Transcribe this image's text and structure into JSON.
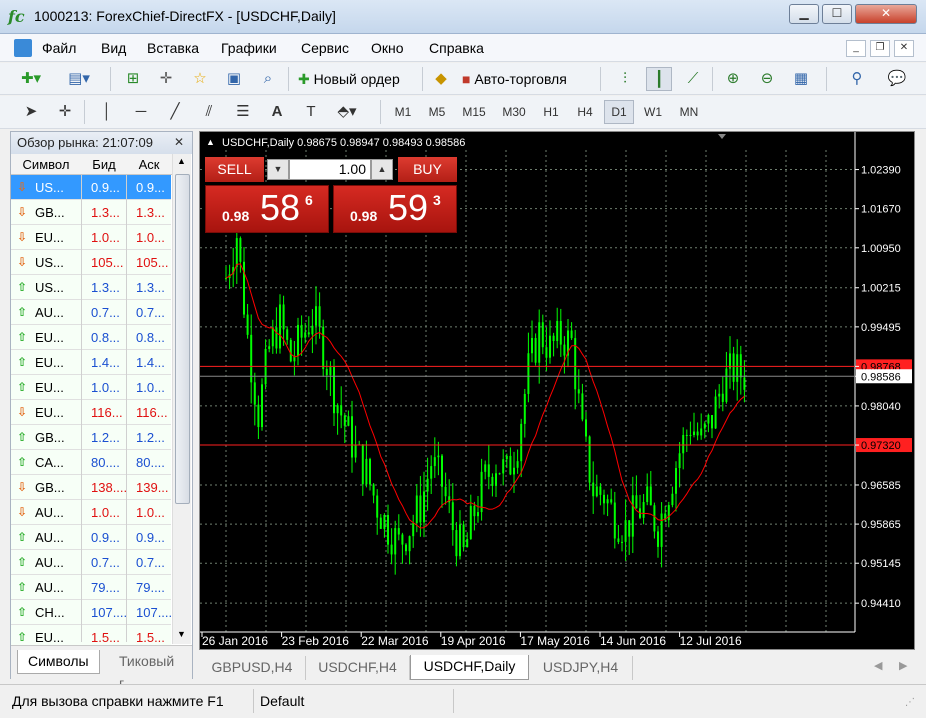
{
  "window": {
    "title": "1000213: ForexChief-DirectFX - [USDCHF,Daily]",
    "app_icon": "fc"
  },
  "menu": [
    "Файл",
    "Вид",
    "Вставка",
    "Графики",
    "Сервис",
    "Окно",
    "Справка"
  ],
  "toolbar1": {
    "new_order": "Новый ордер",
    "auto_trading": "Авто-торговля"
  },
  "timeframes": [
    "M1",
    "M5",
    "M15",
    "M30",
    "H1",
    "H4",
    "D1",
    "W1",
    "MN"
  ],
  "active_timeframe": "D1",
  "market_watch": {
    "title": "Обзор рынка: 21:07:09",
    "col_symbol": "Символ",
    "col_bid": "Бид",
    "col_ask": "Аск",
    "rows": [
      {
        "sym": "US...",
        "bid": "0.9...",
        "ask": "0.9...",
        "dir": "down",
        "color": "blue"
      },
      {
        "sym": "GB...",
        "bid": "1.3...",
        "ask": "1.3...",
        "dir": "down",
        "color": "red"
      },
      {
        "sym": "EU...",
        "bid": "1.0...",
        "ask": "1.0...",
        "dir": "down",
        "color": "red"
      },
      {
        "sym": "US...",
        "bid": "105...",
        "ask": "105...",
        "dir": "down",
        "color": "red"
      },
      {
        "sym": "US...",
        "bid": "1.3...",
        "ask": "1.3...",
        "dir": "up",
        "color": "blue"
      },
      {
        "sym": "AU...",
        "bid": "0.7...",
        "ask": "0.7...",
        "dir": "up",
        "color": "blue"
      },
      {
        "sym": "EU...",
        "bid": "0.8...",
        "ask": "0.8...",
        "dir": "up",
        "color": "blue"
      },
      {
        "sym": "EU...",
        "bid": "1.4...",
        "ask": "1.4...",
        "dir": "up",
        "color": "blue"
      },
      {
        "sym": "EU...",
        "bid": "1.0...",
        "ask": "1.0...",
        "dir": "up",
        "color": "blue"
      },
      {
        "sym": "EU...",
        "bid": "116...",
        "ask": "116...",
        "dir": "down",
        "color": "red"
      },
      {
        "sym": "GB...",
        "bid": "1.2...",
        "ask": "1.2...",
        "dir": "up",
        "color": "blue"
      },
      {
        "sym": "CA...",
        "bid": "80....",
        "ask": "80....",
        "dir": "up",
        "color": "blue"
      },
      {
        "sym": "GB...",
        "bid": "138....",
        "ask": "139...",
        "dir": "down",
        "color": "red"
      },
      {
        "sym": "AU...",
        "bid": "1.0...",
        "ask": "1.0...",
        "dir": "down",
        "color": "red"
      },
      {
        "sym": "AU...",
        "bid": "0.9...",
        "ask": "0.9...",
        "dir": "up",
        "color": "blue"
      },
      {
        "sym": "AU...",
        "bid": "0.7...",
        "ask": "0.7...",
        "dir": "up",
        "color": "blue"
      },
      {
        "sym": "AU...",
        "bid": "79....",
        "ask": "79....",
        "dir": "up",
        "color": "blue"
      },
      {
        "sym": "CH...",
        "bid": "107....",
        "ask": "107....",
        "dir": "up",
        "color": "blue"
      },
      {
        "sym": "EU...",
        "bid": "1.5...",
        "ask": "1.5...",
        "dir": "up",
        "color": "red"
      }
    ],
    "tabs": [
      "Символы",
      "Тиковый г"
    ]
  },
  "chart": {
    "info": "USDCHF,Daily  0.98675 0.98947 0.98493 0.98586",
    "sell_label": "SELL",
    "buy_label": "BUY",
    "volume": "1.00",
    "sell_prefix": "0.98",
    "sell_big": "58",
    "sell_sup": "6",
    "buy_prefix": "0.98",
    "buy_big": "59",
    "buy_sup": "3"
  },
  "chart_data": {
    "type": "line",
    "price_levels": [
      "1.02390",
      "1.01670",
      "1.00950",
      "1.00215",
      "0.99495",
      "0.98768",
      "0.98586",
      "0.98040",
      "0.97320",
      "0.96585",
      "0.95865",
      "0.95145",
      "0.94410"
    ],
    "highlighted_levels": {
      "red_1": "0.98768",
      "red_2": "0.97320",
      "current": "0.98586"
    },
    "date_labels": [
      "26 Jan 2016",
      "23 Feb 2016",
      "22 Mar 2016",
      "19 Apr 2016",
      "17 May 2016",
      "14 Jun 2016",
      "12 Jul 2016"
    ],
    "ma_color": "#ff0000",
    "candle_color": "#00ff00"
  },
  "chart_tabs": [
    "GBPUSD,H4",
    "USDCHF,H4",
    "USDCHF,Daily",
    "USDJPY,H4"
  ],
  "active_chart_tab": "USDCHF,Daily",
  "status": {
    "help": "Для вызова справки нажмите F1",
    "profile": "Default"
  }
}
